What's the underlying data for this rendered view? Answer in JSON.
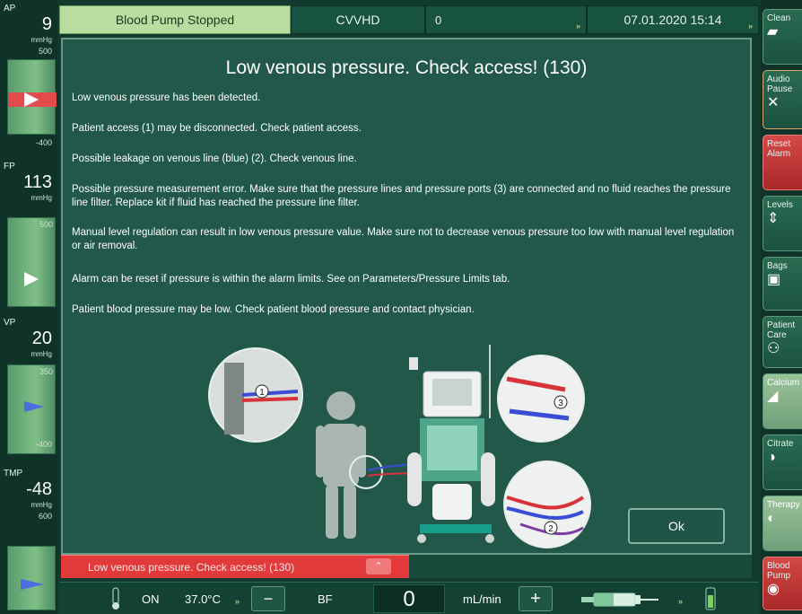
{
  "topbar": {
    "status": "Blood Pump Stopped",
    "mode": "CVVHD",
    "count": "0",
    "datetime": "07.01.2020 15:14",
    "more": "»"
  },
  "gauges": [
    {
      "name": "AP",
      "value": "9",
      "unit": "mmHg",
      "upper": "500",
      "lower": "-400"
    },
    {
      "name": "FP",
      "value": "113",
      "unit": "mmHg",
      "upper": "500",
      "lower": ""
    },
    {
      "name": "VP",
      "value": "20",
      "unit": "mmHg",
      "upper": "350",
      "lower": "-400"
    },
    {
      "name": "TMP",
      "value": "-48",
      "unit": "mmHg",
      "upper": "600",
      "lower": ""
    }
  ],
  "right_buttons": [
    {
      "label": "Clean",
      "icon": "clean-icon"
    },
    {
      "label": "Audio Pause",
      "icon": "audio-pause-icon"
    },
    {
      "label": "Reset Alarm",
      "icon": "reset-alarm-icon"
    },
    {
      "label": "Levels",
      "icon": "levels-icon"
    },
    {
      "label": "Bags",
      "icon": "bags-icon"
    },
    {
      "label": "Patient Care",
      "icon": "patient-care-icon"
    },
    {
      "label": "Calcium",
      "icon": "calcium-icon"
    },
    {
      "label": "Citrate",
      "icon": "citrate-icon"
    },
    {
      "label": "Therapy",
      "icon": "therapy-icon"
    },
    {
      "label": "Blood Pump",
      "icon": "blood-pump-icon"
    }
  ],
  "dialog": {
    "title": "Low venous pressure. Check access! (130)",
    "messages": [
      "Low venous pressure has been detected.",
      "Patient access (1) may be disconnected. Check patient access.",
      "Possible leakage on venous line (blue) (2). Check venous line.",
      "Possible pressure measurement error. Make sure that the pressure lines and pressure ports (3) are connected and no fluid reaches the pressure line filter. Replace kit if fluid has reached the pressure line filter.",
      "Manual level regulation can result in low venous pressure value. Make sure not to decrease venous pressure too low with manual level regulation or air removal.",
      "Alarm can be reset if pressure is within the alarm limits. See on Parameters/Pressure Limits tab.",
      "Patient blood pressure may be low. Check patient blood pressure and contact physician."
    ],
    "callouts": [
      "1",
      "2",
      "3"
    ],
    "ok_label": "Ok"
  },
  "alarm_bar": {
    "text": "Low venous pressure. Check access! (130)",
    "chevron": "⌃"
  },
  "bottom": {
    "heater_state": "ON",
    "temperature": "37.0°C",
    "more": "»",
    "minus": "−",
    "flow_label": "BF",
    "flow_value": "0",
    "flow_unit": "mL/min",
    "plus": "+",
    "more2": "»"
  }
}
